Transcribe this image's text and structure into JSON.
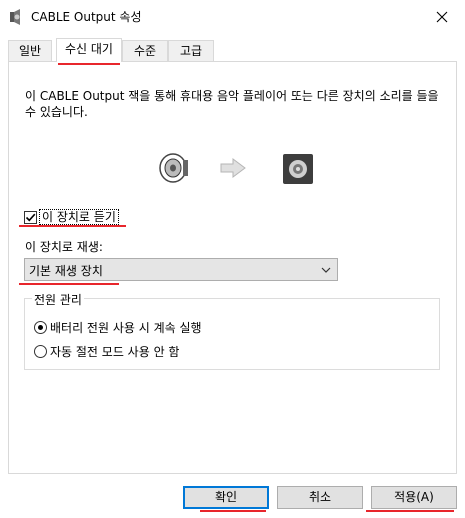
{
  "window": {
    "title": "CABLE Output 속성"
  },
  "tabs": [
    {
      "label": "일반"
    },
    {
      "label": "수신 대기"
    },
    {
      "label": "수준"
    },
    {
      "label": "고급"
    }
  ],
  "description": "이 CABLE Output 잭을 통해 휴대용 음악 플레이어 또는 다른 장치의 소리를 들을 수 있습니다.",
  "listen": {
    "label": "이 장치로 듣기",
    "checked": true
  },
  "playback": {
    "label": "이 장치로 재생:",
    "selected": "기본 재생 장치"
  },
  "power": {
    "title": "전원 관리",
    "options": [
      {
        "label": "배터리 전원 사용 시 계속 실행",
        "selected": true
      },
      {
        "label": "자동 절전 모드 사용 안 함",
        "selected": false
      }
    ]
  },
  "buttons": {
    "ok": "확인",
    "cancel": "취소",
    "apply": "적용(A)"
  },
  "colors": {
    "annotation": "#e8262c",
    "accent": "#0078d7"
  }
}
